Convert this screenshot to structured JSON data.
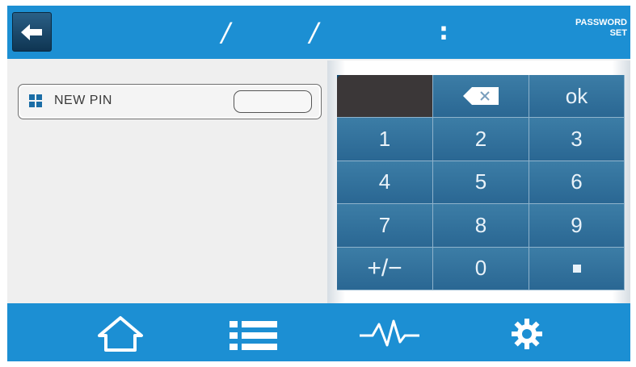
{
  "header": {
    "date_separators": "/ /",
    "time_separator": ":",
    "title_line1": "PASSWORD",
    "title_line2": "SET",
    "back_icon": "back-arrow-icon"
  },
  "form": {
    "pin_label": "NEW PIN",
    "pin_value": "",
    "pin_icon": "grid-icon"
  },
  "keypad": {
    "backspace_icon": "backspace-icon",
    "ok": "ok",
    "keys": [
      "1",
      "2",
      "3",
      "4",
      "5",
      "6",
      "7",
      "8",
      "9",
      "+/−",
      "0"
    ],
    "dot_icon": "decimal-point-icon"
  },
  "nav": {
    "items": [
      "home-icon",
      "menu-list-icon",
      "waveform-icon",
      "settings-gear-icon"
    ]
  },
  "colors": {
    "bar_blue": "#1c8fd3",
    "key_blue": "#2f6f9c",
    "display_dark": "#3b3738",
    "background": "#efefef"
  }
}
